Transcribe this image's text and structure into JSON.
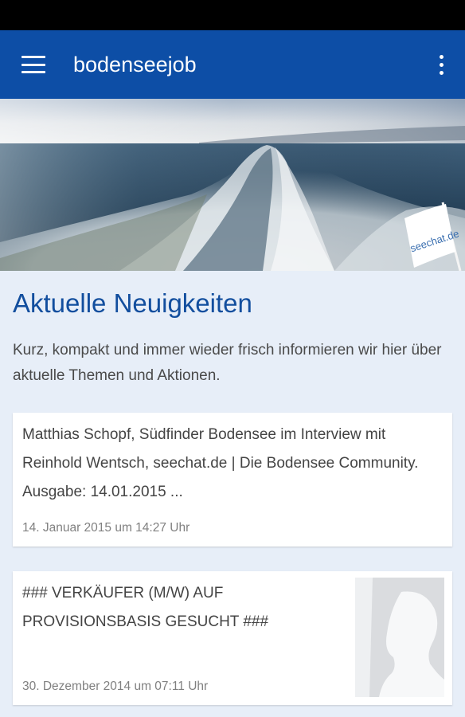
{
  "app_bar": {
    "title": "bodenseejob",
    "menu_icon": "hamburger-menu-icon",
    "overflow_icon": "more-vert-icon",
    "background_color": "#0d4ea6"
  },
  "hero_image": {
    "flag_text": "seechat.de"
  },
  "section": {
    "title": "Aktuelle Neuigkeiten",
    "description": "Kurz, kompakt und immer wieder frisch informieren wir hier über aktuelle Themen und Aktionen.",
    "title_color": "#124e9e"
  },
  "news": [
    {
      "text": "Matthias Schopf, Südfinder Bodensee im Interview mit Reinhold Wentsch, seechat.de | Die Bodensee Community. Ausgabe: 14.01.2015 ...",
      "date": "14. Januar 2015 um 14:27 Uhr"
    },
    {
      "text": "### VERKÄUFER (M/W) AUF PROVISIONSBASIS GESUCHT ###",
      "date": "30. Dezember 2014 um 07:11 Uhr",
      "thumbnail_icon": "person-placeholder-icon"
    }
  ]
}
